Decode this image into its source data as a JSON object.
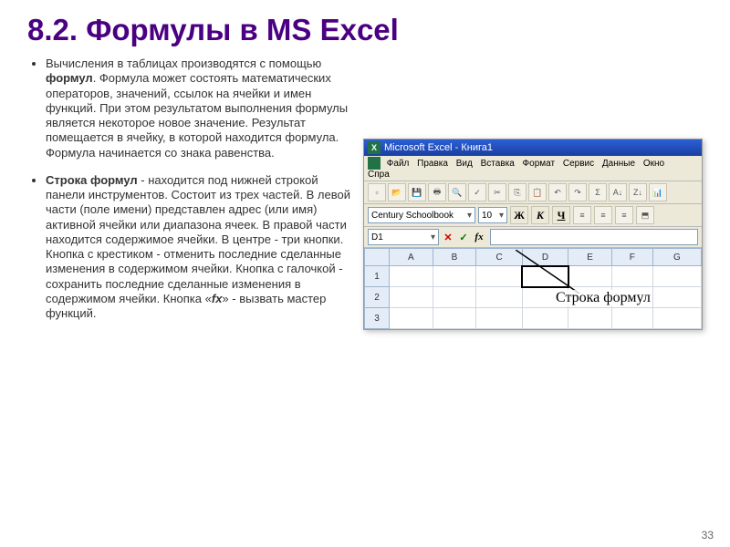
{
  "title": "8.2. Формулы в MS Excel",
  "paragraphs": {
    "p1_pre": "Вычисления в таблицах производятся с помощью ",
    "p1_b": "формул",
    "p1_post": ". Формула может состоять математических операторов, значений, ссылок на ячейки и имен функций. При этом результатом выполнения формулы является некоторое новое значение. Результат помещается в ячейку, в которой находится формула. Формула начинается со знака равенства.",
    "p2_b": "Строка формул",
    "p2_mid": " - находится под нижней строкой панели инструментов. Состоит из трех частей. В левой части (поле имени) представлен адрес (или имя) активной ячейки или диапазона ячеек. В правой части находится содержимое ячейки. В центре - три кнопки. Кнопка с крестиком - отменить последние сделанные изменения в содержимом ячейки. Кнопка с галочкой - сохранить последние сделанные изменения в содержимом ячейки. Кнопка «",
    "p2_fx": "fx",
    "p2_end": "» - вызвать мастер функций."
  },
  "excel": {
    "app_icon": "X",
    "window_title": "Microsoft Excel - Книга1",
    "menu": [
      "Файл",
      "Правка",
      "Вид",
      "Вставка",
      "Формат",
      "Сервис",
      "Данные",
      "Окно",
      "Спра"
    ],
    "font_name": "Century Schoolbook",
    "font_size": "10",
    "bold_label": "Ж",
    "italic_label": "К",
    "underline_label": "Ч",
    "namebox": "D1",
    "cancel": "✕",
    "confirm": "✓",
    "fx": "fx",
    "cols": [
      "A",
      "B",
      "C",
      "D",
      "E",
      "F",
      "G"
    ],
    "rows": [
      "1",
      "2",
      "3"
    ]
  },
  "annotation": "Строка формул",
  "page_number": "33"
}
